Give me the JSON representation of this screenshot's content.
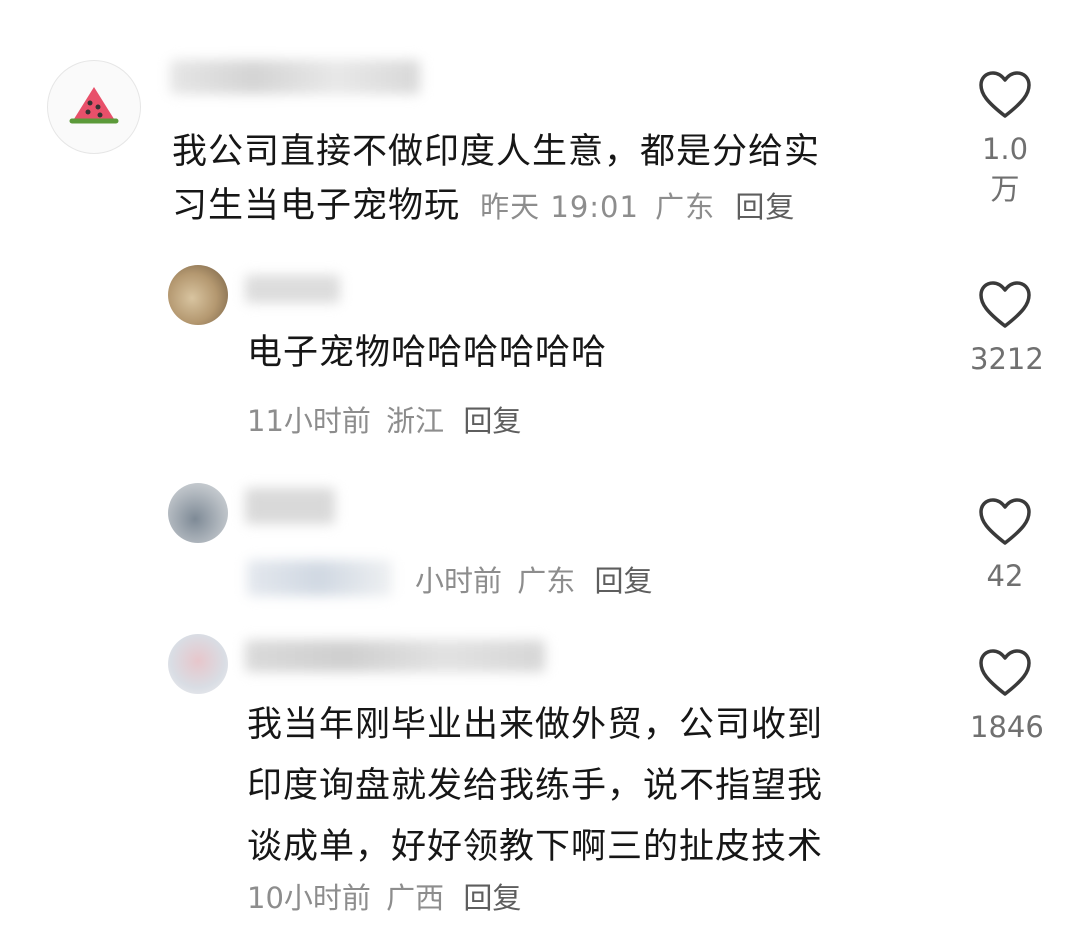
{
  "comments": [
    {
      "text_line1": "我公司直接不做印度人生意，都是分给实",
      "text_line2": "习生当电子宠物玩",
      "time": "昨天 19:01",
      "location": "广东",
      "reply_label": "回复",
      "likes": "1.0万",
      "avatar_icon": "watermelon-icon"
    },
    {
      "text": "电子宠物哈哈哈哈哈哈",
      "time": "11小时前",
      "location": "浙江",
      "reply_label": "回复",
      "likes": "3212"
    },
    {
      "time_partial": "小时前",
      "location": "广东",
      "reply_label": "回复",
      "likes": "42"
    },
    {
      "text_line1": "我当年刚毕业出来做外贸，公司收到",
      "text_line2": "印度询盘就发给我练手，说不指望我",
      "text_line3": "谈成单，好好领教下啊三的扯皮技术",
      "time": "10小时前",
      "location": "广西",
      "reply_label": "回复",
      "likes": "1846"
    }
  ]
}
